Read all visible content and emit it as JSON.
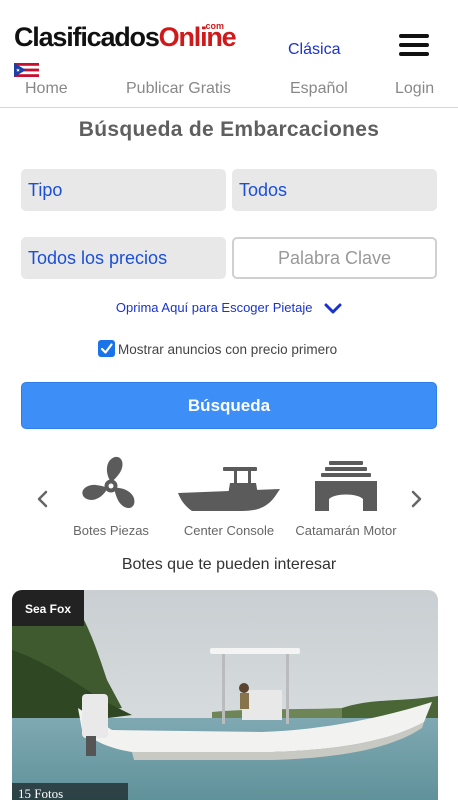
{
  "header": {
    "logo_main": "Clasificados",
    "logo_brand": "Online",
    "logo_com": ".com",
    "clasica_link": "Clásica",
    "menu_icon": "hamburger-icon",
    "flag_icon": "puerto-rico-flag-icon"
  },
  "nav": {
    "items": [
      {
        "label": "Home"
      },
      {
        "label": "Publicar Gratis"
      },
      {
        "label": "Español"
      },
      {
        "label": "Login"
      }
    ]
  },
  "search": {
    "title": "Búsqueda de Embarcaciones",
    "tipo": "Tipo",
    "todos": "Todos",
    "precios": "Todos los precios",
    "keyword_placeholder": "Palabra Clave",
    "pies_link": "Oprima Aquí para Escoger Pietaje",
    "checkbox_label": "Mostrar anuncios con precio primero",
    "checkbox_checked": true,
    "button_label": "Búsqueda"
  },
  "categories": {
    "items": [
      {
        "label": "Botes Piezas",
        "icon": "propeller-icon"
      },
      {
        "label": "Center Console",
        "icon": "center-console-boat-icon"
      },
      {
        "label": "Catamarán Motor",
        "icon": "catamaran-icon"
      }
    ]
  },
  "interest": {
    "heading": "Botes que te pueden interesar"
  },
  "listing": {
    "badge": "Sea Fox",
    "photo_count": "15 Fotos"
  },
  "colors": {
    "accent_blue": "#3e8ef7",
    "link_blue": "#1a33cc",
    "brand_red": "#d0191b",
    "field_bg": "#e8e8e8"
  }
}
